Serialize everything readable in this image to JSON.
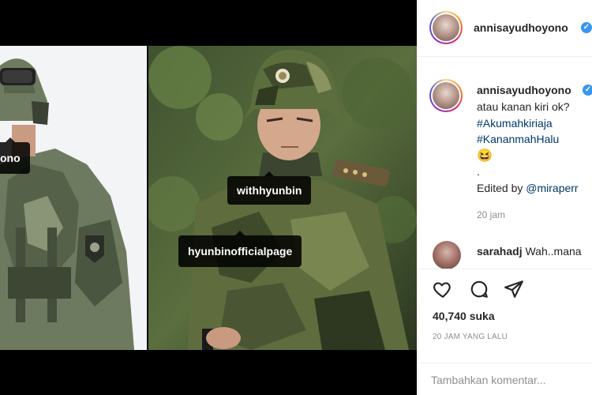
{
  "post": {
    "author": "annisayudhoyono",
    "caption_username": "annisayudhoyono",
    "caption_lines": [
      "atau kanan kiri ok?"
    ],
    "hashtags": [
      "#Akumahkiriaja",
      "#KananmahHalu"
    ],
    "emoji": "😆",
    "dot": ".",
    "edited_prefix": "Edited by ",
    "edited_mention": "@miraperr",
    "caption_time": "20 jam",
    "likes": "40,740 suka",
    "posted_ago": "20 JAM YANG LALU",
    "comment_placeholder": "Tambahkan komentar..."
  },
  "comment": {
    "username": "sarahadj",
    "text": "Wah..mana"
  },
  "photo_tags": {
    "left_tag": "ono",
    "right_tag_1": "withhyunbin",
    "right_tag_2": "hyunbinofficialpage"
  },
  "icons": {
    "like": "heart-icon",
    "comment": "comment-bubble-icon",
    "share": "paper-plane-icon",
    "verified": "verified-badge-icon"
  },
  "colors": {
    "verified": "#3897f0",
    "hashtag": "#00376b",
    "muted": "#8e8e8e",
    "text": "#262626"
  }
}
